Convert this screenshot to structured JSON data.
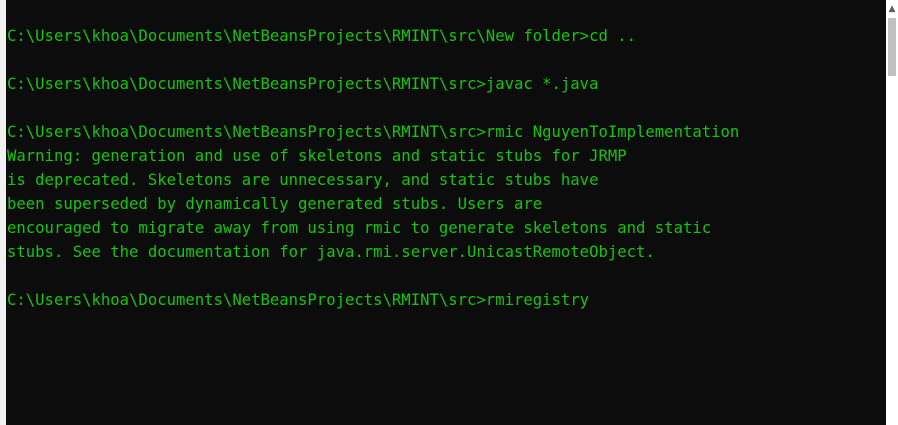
{
  "theme": {
    "background": "#0c0c0c",
    "foreground": "#16c60c"
  },
  "console": {
    "lines": [
      "C:\\Users\\khoa\\Documents\\NetBeansProjects\\RMINT\\src\\New folder>cd ..",
      "",
      "C:\\Users\\khoa\\Documents\\NetBeansProjects\\RMINT\\src>javac *.java",
      "",
      "C:\\Users\\khoa\\Documents\\NetBeansProjects\\RMINT\\src>rmic NguyenToImplementation",
      "Warning: generation and use of skeletons and static stubs for JRMP",
      "is deprecated. Skeletons are unnecessary, and static stubs have",
      "been superseded by dynamically generated stubs. Users are",
      "encouraged to migrate away from using rmic to generate skeletons and static",
      "stubs. See the documentation for java.rmi.server.UnicastRemoteObject.",
      "",
      "C:\\Users\\khoa\\Documents\\NetBeansProjects\\RMINT\\src>rmiregistry"
    ]
  },
  "scrollbar": {
    "up_arrow_icon": "triangle-up-icon",
    "up_arrow_glyph": "▲"
  }
}
